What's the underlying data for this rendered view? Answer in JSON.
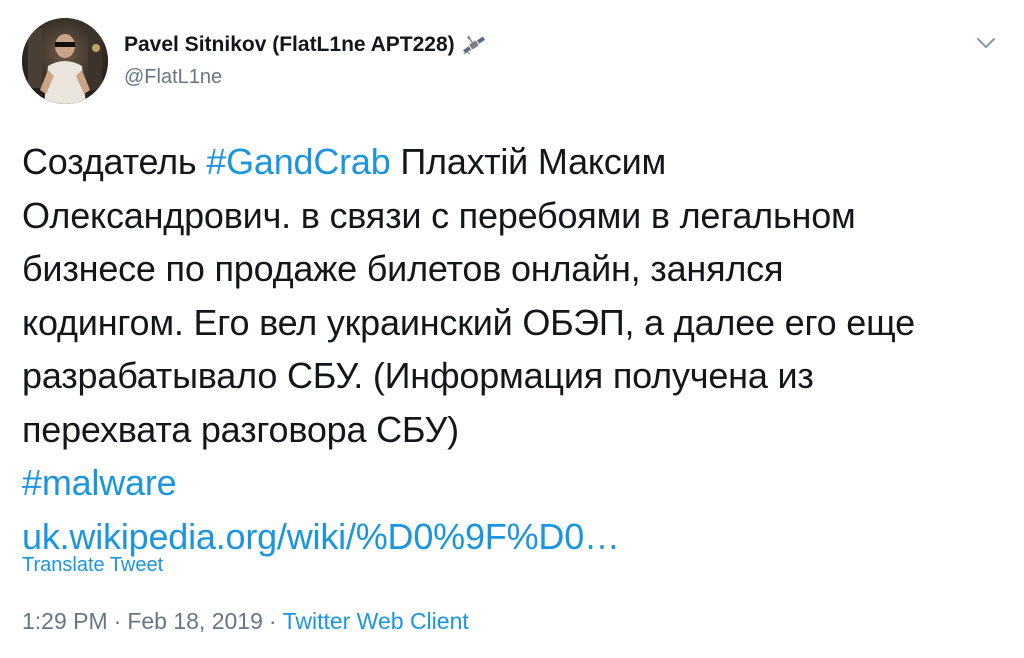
{
  "user": {
    "display_name": "Pavel Sitnikov (FlatL1ne APT228)",
    "handle": "@FlatL1ne"
  },
  "tweet": {
    "line1_prefix": "Создатель ",
    "hashtag_gandcrab": "#GandCrab",
    "line1_suffix": " Плахтій Максим",
    "line2": "Олександрович. в связи с перебоями в легальном",
    "line3": "бизнесе по продаже билетов онлайн, занялся",
    "line4": "кодингом. Его вел украинский ОБЭП, а далее его еще",
    "line5": "разрабатывало СБУ. (Информация получена из",
    "line6": "перехвата разговора СБУ)",
    "hashtag_malware": "#malware",
    "link_text": "uk.wikipedia.org/wiki/%D0%9F%D0…"
  },
  "translate_label": "Translate Tweet",
  "meta": {
    "time": "1:29 PM",
    "dot1": "·",
    "date": "Feb 18, 2019",
    "dot2": "·",
    "source": "Twitter Web Client"
  },
  "icons": {
    "verified_like": "satellite-icon",
    "menu": "chevron-down-icon"
  },
  "colors": {
    "link": "#1b95e0",
    "secondary": "#657786",
    "text": "#14171a"
  }
}
